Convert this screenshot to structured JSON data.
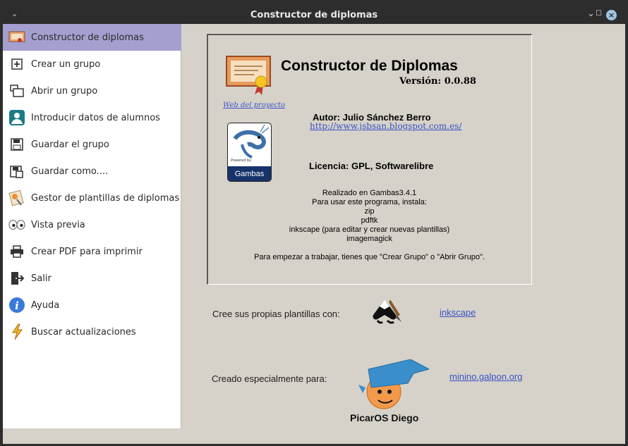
{
  "window": {
    "title": "Constructor de diplomas"
  },
  "sidebar": {
    "items": [
      {
        "label": "Constructor de diplomas",
        "icon": "diploma-icon",
        "selected": true
      },
      {
        "label": "Crear un grupo",
        "icon": "add-icon"
      },
      {
        "label": "Abrir un grupo",
        "icon": "open-folder-icon"
      },
      {
        "label": "Introducir datos de alumnos",
        "icon": "user-icon"
      },
      {
        "label": "Guardar el grupo",
        "icon": "save-icon"
      },
      {
        "label": "Guardar como....",
        "icon": "save-as-icon"
      },
      {
        "label": "Gestor de plantillas de diplomas",
        "icon": "template-icon"
      },
      {
        "label": "Vista previa",
        "icon": "eyes-icon"
      },
      {
        "label": "Crear PDF para imprimir",
        "icon": "printer-icon"
      },
      {
        "label": "Salir",
        "icon": "exit-icon"
      },
      {
        "label": "Ayuda",
        "icon": "info-icon"
      },
      {
        "label": "Buscar actualizaciones",
        "icon": "lightning-icon"
      }
    ]
  },
  "about": {
    "title": "Constructor de Diplomas",
    "version": "Versión: 0.0.88",
    "web_link": "Web del proyecto",
    "author": "Autor: Julio Sánchez Berro",
    "blog_link": "http://www.jsbsan.blogspot.com.es/",
    "gambas_badge": "Gambas",
    "gambas_powered": "Powered by",
    "license": "Licencia: GPL, Softwarelibre",
    "info_lines": [
      "Realizado en Gambas3.4.1",
      "Para usar este programa, instala:",
      "zip",
      "pdftk",
      "inkscape (para editar y crear nuevas plantillas)",
      "imagemagick"
    ],
    "start_hint": "Para empezar a trabajar, tienes que \"Crear Grupo\" o \"Abrir Grupo\"."
  },
  "bottom": {
    "templates_label": "Cree sus propias plantillas con:",
    "inkscape_link": "inkscape",
    "created_label": "Creado especialmente para:",
    "minino_link": "minino.galpon.org",
    "picaros_name": "PicarOS Diego"
  },
  "colors": {
    "selected_bg": "#a49fcf",
    "link": "#3a50c7",
    "panel_bg": "#d6d2c9",
    "titlebar": "#2d2d2d"
  }
}
